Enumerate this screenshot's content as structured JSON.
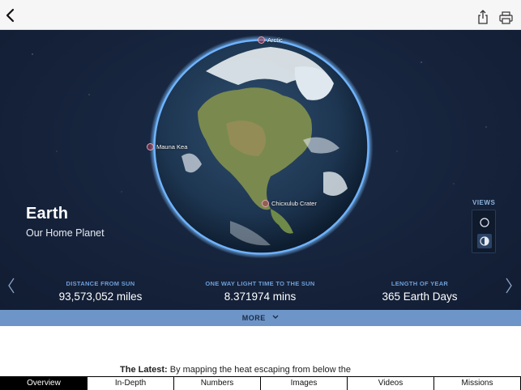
{
  "toolbar": {
    "back_icon": "chevron-left-icon",
    "share_icon": "share-icon",
    "print_icon": "printer-icon"
  },
  "planet": {
    "name": "Earth",
    "subtitle": "Our Home Planet"
  },
  "points_of_interest": [
    {
      "label": "Arctic"
    },
    {
      "label": "Mauna Kea"
    },
    {
      "label": "Chicxulub Crater"
    }
  ],
  "views": {
    "label": "VIEWS",
    "options": [
      {
        "icon": "circle-outline-icon"
      },
      {
        "icon": "half-shaded-circle-icon",
        "selected": true
      }
    ]
  },
  "stats": [
    {
      "label": "DISTANCE FROM SUN",
      "value": "93,573,052 miles"
    },
    {
      "label": "ONE WAY LIGHT TIME TO THE SUN",
      "value": "8.371974 mins"
    },
    {
      "label": "LENGTH OF YEAR",
      "value": "365 Earth Days"
    }
  ],
  "more": {
    "label": "MORE"
  },
  "latest": {
    "prefix": "The Latest:",
    "text": " By mapping the heat escaping from below the"
  },
  "tabs": [
    {
      "label": "Overview",
      "active": true
    },
    {
      "label": "In-Depth"
    },
    {
      "label": "Numbers"
    },
    {
      "label": "Images"
    },
    {
      "label": "Videos"
    },
    {
      "label": "Missions"
    }
  ],
  "colors": {
    "hero_bg": "#16233b",
    "accent_blue": "#6d95c8",
    "stat_label": "#6f9fd8"
  }
}
